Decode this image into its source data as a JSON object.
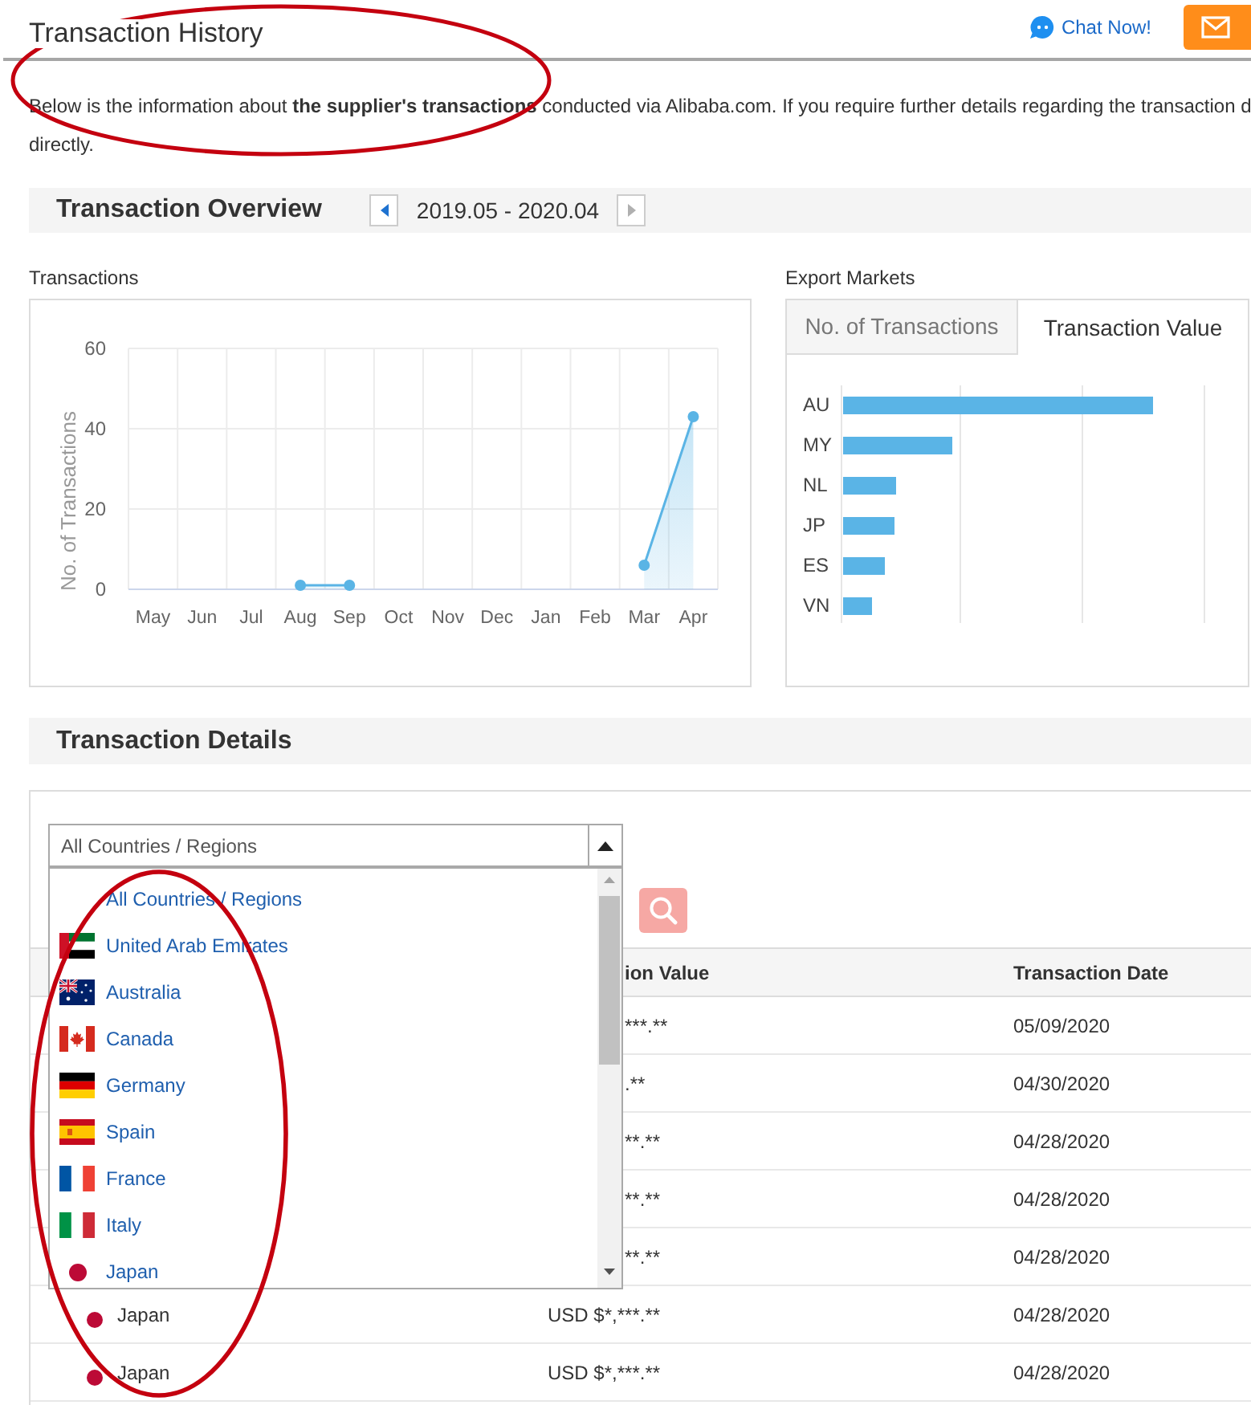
{
  "header": {
    "title": "Transaction History",
    "chat_link": "Chat Now!"
  },
  "intro": {
    "lines": [
      "Below is the information about **the supplier's transactions** conducted via Alibaba.com. If you require further details regarding the transaction d",
      "directly."
    ]
  },
  "overview": {
    "title": "Transaction Overview",
    "period": "2019.05 - 2020.04",
    "prev_button": {
      "disabled": false
    },
    "next_button": {
      "disabled": true
    }
  },
  "transactions": {
    "chart_data": {
      "type": "area",
      "title": "Transactions",
      "ylabel": "No. of Transactions",
      "categories": [
        "May",
        "Jun",
        "Jul",
        "Aug",
        "Sep",
        "Oct",
        "Nov",
        "Dec",
        "Jan",
        "Feb",
        "Mar",
        "Apr"
      ],
      "series": [
        {
          "color": "#5ab4e5",
          "values": [
            null,
            null,
            null,
            1,
            1,
            null,
            null,
            null,
            null,
            null,
            6,
            43
          ]
        }
      ],
      "ylim": [
        0,
        60
      ],
      "yticks": [
        0,
        20,
        40,
        60
      ]
    }
  },
  "export_markets": {
    "label": "Export Markets",
    "tabs": [
      {
        "label": "No. of Transactions",
        "selected": false
      },
      {
        "label": "Transaction Value",
        "selected": true
      }
    ],
    "markets": [
      {
        "label": "AU"
      },
      {
        "label": "MY"
      },
      {
        "label": "NL"
      },
      {
        "label": "JP"
      },
      {
        "label": "ES"
      },
      {
        "label": "VN"
      }
    ]
  },
  "details": {
    "title": "Transaction Details",
    "country_select": {
      "value": "All Countries / Regions",
      "expanded": true,
      "options": [
        {
          "label": "All Countries / Regions"
        },
        {
          "label": "United Arab Emirates"
        },
        {
          "label": "Australia"
        },
        {
          "label": "Canada"
        },
        {
          "label": "Germany"
        },
        {
          "label": "Spain"
        },
        {
          "label": "France"
        },
        {
          "label": "Italy"
        },
        {
          "label": "Japan"
        }
      ]
    },
    "table": {
      "columns": [
        {
          "label": "ion Value"
        },
        {
          "label": "Transaction Date"
        }
      ],
      "rows": [
        {
          "value": "***.**",
          "date": "05/09/2020"
        },
        {
          "value": ".**",
          "date": "04/30/2020"
        },
        {
          "value": "**.**",
          "date": "04/28/2020"
        },
        {
          "value": "**.**",
          "date": "04/28/2020"
        },
        {
          "value": "**.**",
          "date": "04/28/2020"
        },
        {
          "country": "Japan",
          "value": "USD $*,***.**",
          "date": "04/28/2020"
        },
        {
          "country": "Japan",
          "value": "USD $*,***.**",
          "date": "04/28/2020"
        }
      ]
    }
  }
}
